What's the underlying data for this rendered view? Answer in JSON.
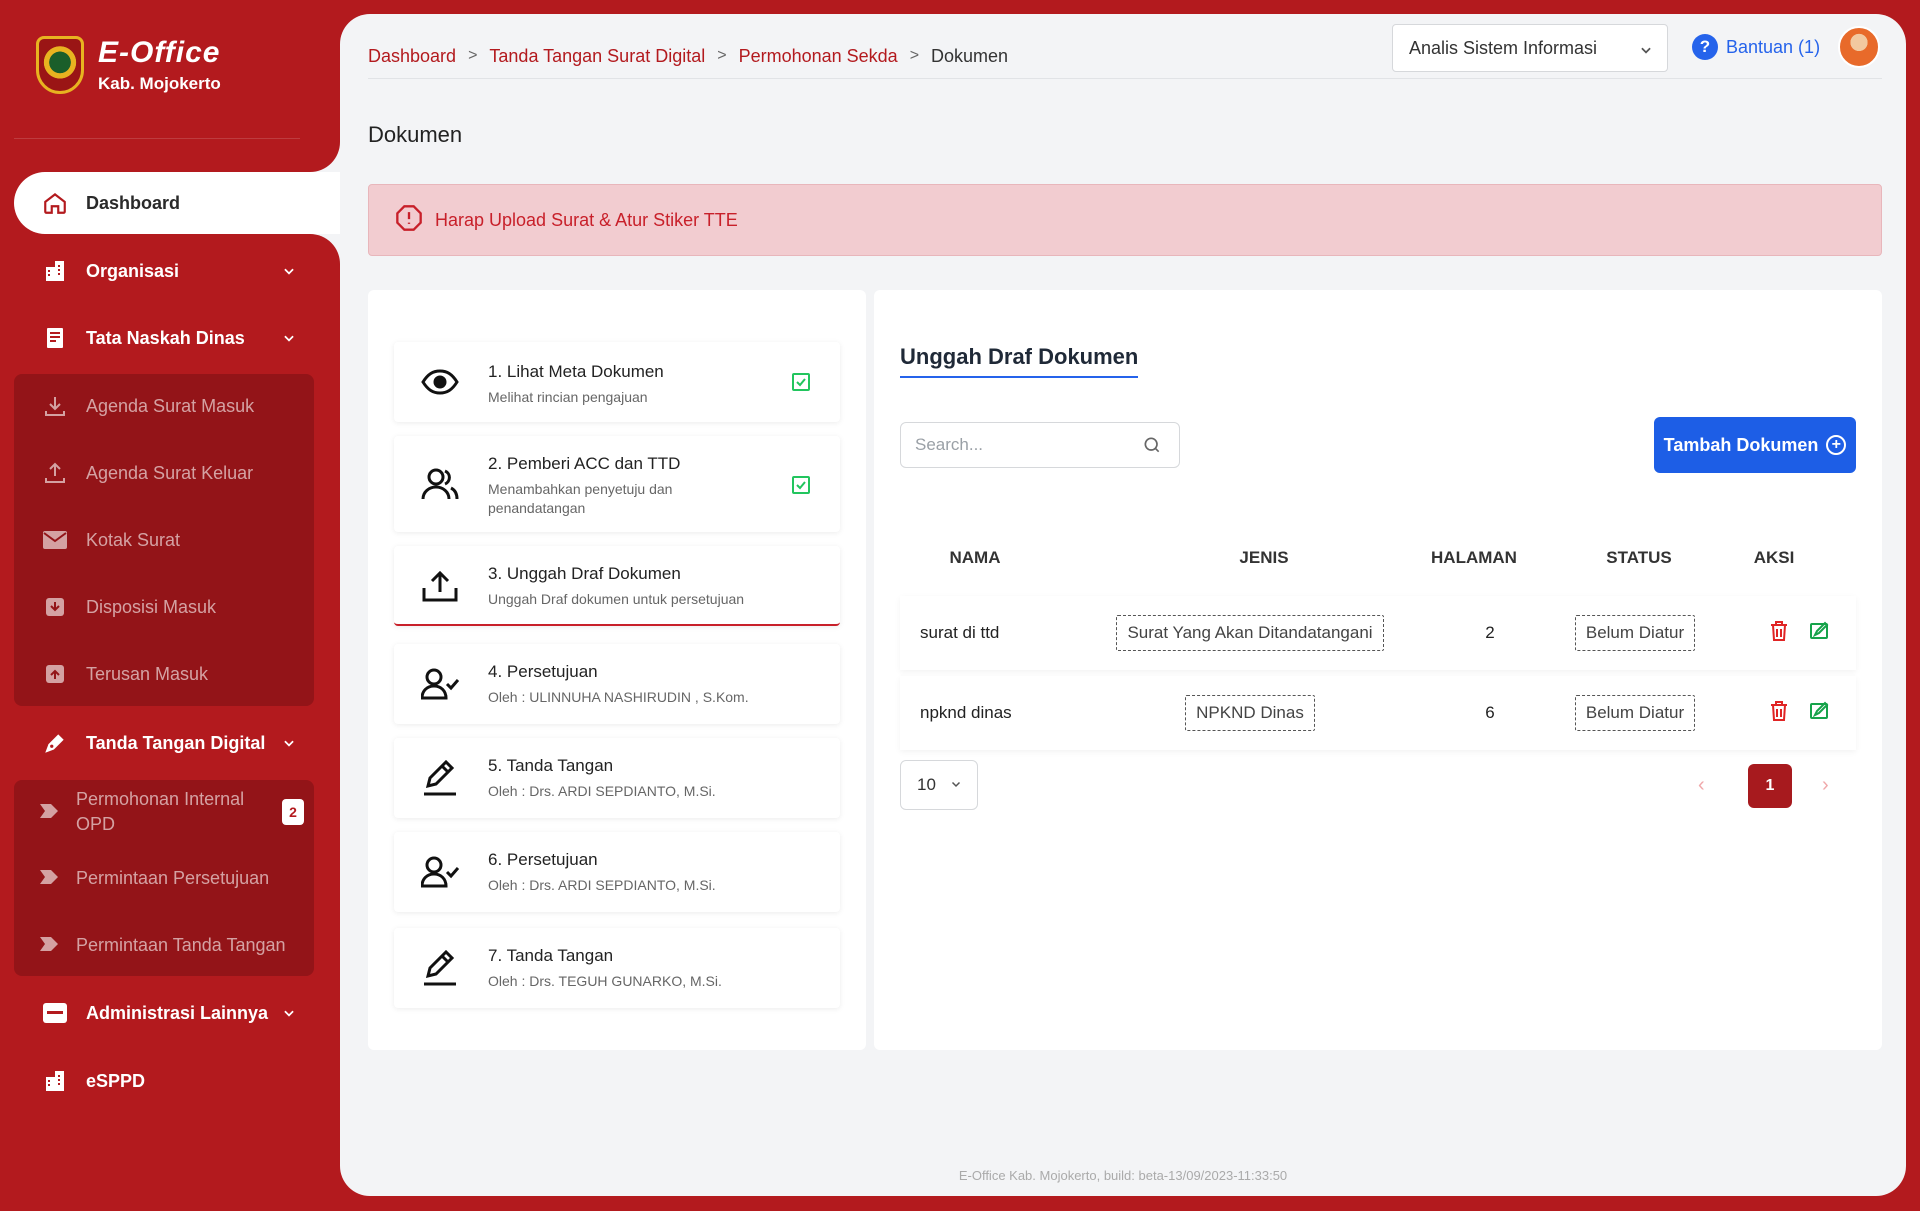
{
  "brand": {
    "title": "E-Office",
    "subtitle": "Kab. Mojokerto"
  },
  "sidebar": {
    "items": [
      {
        "label": "Dashboard",
        "icon": "home-icon",
        "active": true
      },
      {
        "label": "Organisasi",
        "icon": "building-icon"
      },
      {
        "label": "Tata Naskah Dinas",
        "icon": "document-icon"
      },
      {
        "label": "Agenda Surat Masuk",
        "icon": "download-icon"
      },
      {
        "label": "Agenda Surat Keluar",
        "icon": "upload-icon"
      },
      {
        "label": "Kotak Surat",
        "icon": "envelope-icon"
      },
      {
        "label": "Disposisi Masuk",
        "icon": "inbox-down-icon"
      },
      {
        "label": "Terusan Masuk",
        "icon": "inbox-up-icon"
      },
      {
        "label": "Tanda Tangan Digital",
        "icon": "pen-icon"
      },
      {
        "label": "Permohonan Internal OPD",
        "badge": "2"
      },
      {
        "label": "Permintaan Persetujuan"
      },
      {
        "label": "Permintaan Tanda Tangan"
      },
      {
        "label": "Administrasi Lainnya",
        "icon": "archive-icon"
      },
      {
        "label": "eSPPD",
        "icon": "building-icon"
      }
    ]
  },
  "header": {
    "breadcrumb": [
      "Dashboard",
      "Tanda Tangan Surat Digital",
      "Permohonan Sekda",
      "Dokumen"
    ],
    "role": "Analis Sistem Informasi",
    "help": "Bantuan (1)"
  },
  "page": {
    "title": "Dokumen",
    "alert": "Harap Upload Surat & Atur Stiker TTE"
  },
  "steps": [
    {
      "title": "1. Lihat Meta Dokumen",
      "subtitle": "Melihat rincian pengajuan",
      "icon": "eye-icon",
      "done": true
    },
    {
      "title": "2. Pemberi ACC dan TTD",
      "subtitle": "Menambahkan penyetuju dan penandatangan",
      "icon": "users-icon",
      "done": true
    },
    {
      "title": "3. Unggah Draf Dokumen",
      "subtitle": "Unggah Draf dokumen untuk persetujuan",
      "icon": "upload-tray-icon",
      "active": true
    },
    {
      "title": "4. Persetujuan",
      "subtitle": "Oleh : ULINNUHA NASHIRUDIN , S.Kom.",
      "icon": "user-check-icon"
    },
    {
      "title": "5. Tanda Tangan",
      "subtitle": "Oleh : Drs. ARDI SEPDIANTO, M.Si.",
      "icon": "pen-line-icon"
    },
    {
      "title": "6. Persetujuan",
      "subtitle": "Oleh : Drs. ARDI SEPDIANTO, M.Si.",
      "icon": "user-check-icon"
    },
    {
      "title": "7. Tanda Tangan",
      "subtitle": "Oleh : Drs. TEGUH GUNARKO, M.Si.",
      "icon": "pen-line-icon"
    }
  ],
  "docs": {
    "title": "Unggah Draf Dokumen",
    "search_placeholder": "Search...",
    "add_label": "Tambah Dokumen",
    "columns": [
      "NAMA",
      "JENIS",
      "HALAMAN",
      "STATUS",
      "AKSI"
    ],
    "rows": [
      {
        "nama": "surat di ttd",
        "jenis": "Surat Yang Akan Ditandatangani",
        "halaman": "2",
        "status": "Belum Diatur"
      },
      {
        "nama": "npknd dinas",
        "jenis": "NPKND Dinas",
        "halaman": "6",
        "status": "Belum Diatur"
      }
    ],
    "page_size": "10",
    "current_page": "1"
  },
  "footer": "E-Office Kab. Mojokerto, build: beta-13/09/2023-11:33:50",
  "colors": {
    "brand": "#b31a1e",
    "accent": "#1d5ee6",
    "success": "#22c55e"
  }
}
